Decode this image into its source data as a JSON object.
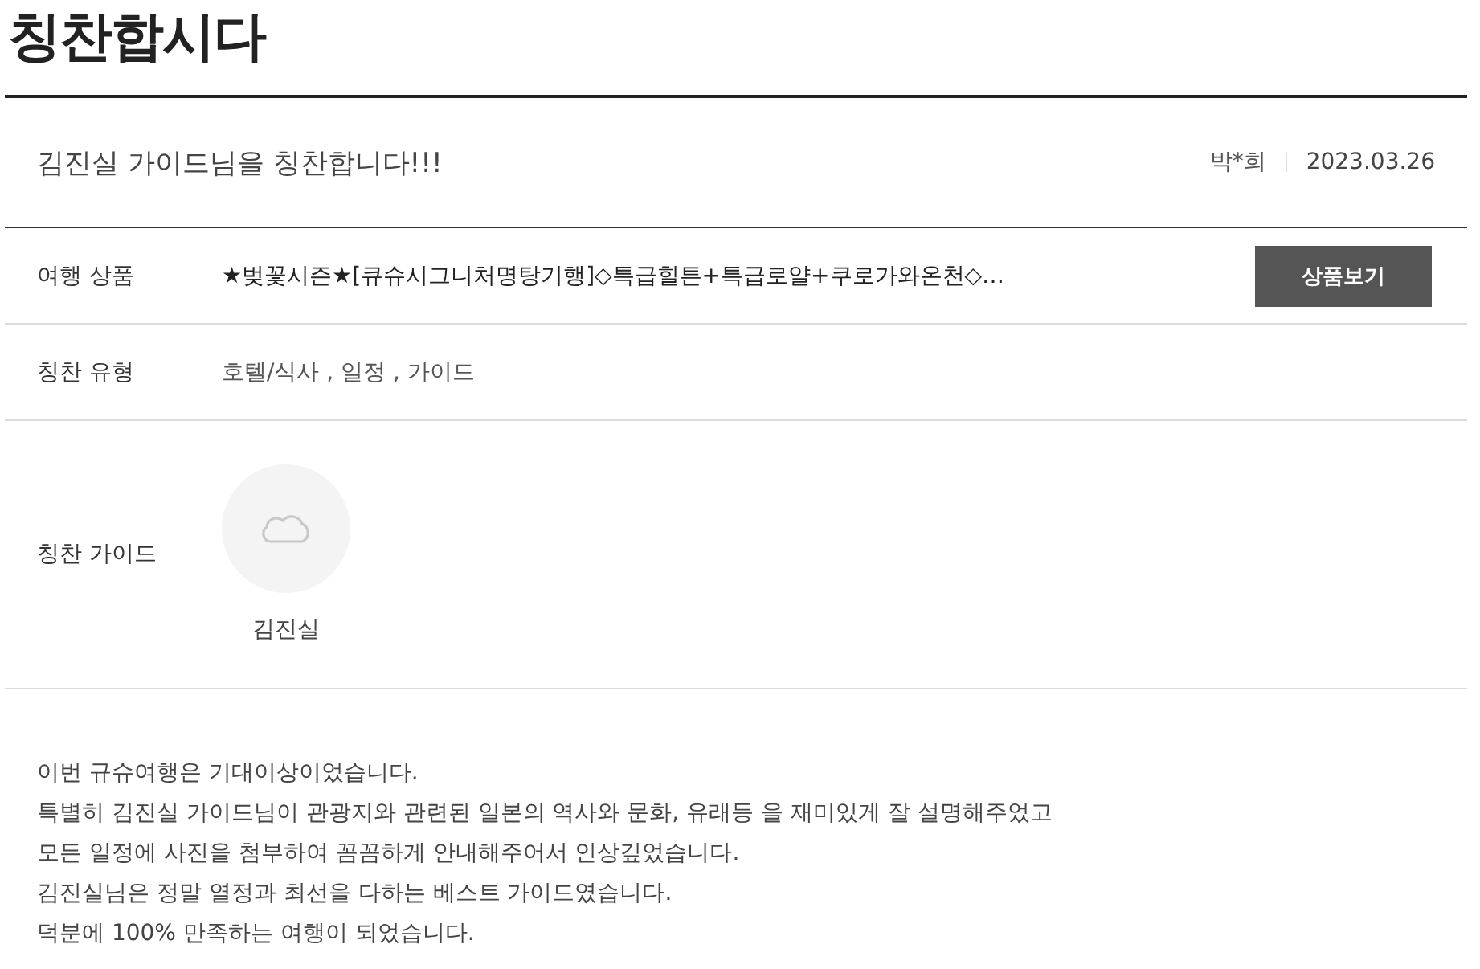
{
  "page": {
    "title": "칭찬합시다"
  },
  "post": {
    "title": "김진실 가이드님을 칭찬합니다!!!",
    "author": "박*희",
    "date": "2023.03.26"
  },
  "details": [
    {
      "kind": "product",
      "label": "여행 상품",
      "value": "★벚꽃시즌★[큐슈시그니처명탕기행]◇특급힐튼+특급로얄+쿠로가와온천◇…",
      "button": "상품보기"
    },
    {
      "kind": "text",
      "label": "칭찬 유형",
      "value": "호텔/식사 , 일정 , 가이드"
    },
    {
      "kind": "guide",
      "label": "칭찬 가이드",
      "guides": [
        {
          "name": "김진실"
        }
      ]
    }
  ],
  "body": {
    "lines": [
      "이번 규슈여행은 기대이상이었습니다.",
      "특별히 김진실 가이드님이 관광지와 관련된 일본의 역사와 문화, 유래등 을 재미있게 잘 설명해주었고",
      "모든 일정에 사진을 첨부하여 꼼꼼하게 안내해주어서 인상깊었습니다.",
      "김진실님은 정말 열정과 최선을 다하는 베스트 가이드였습니다.",
      "덕분에 100% 만족하는 여행이 되었습니다."
    ]
  }
}
